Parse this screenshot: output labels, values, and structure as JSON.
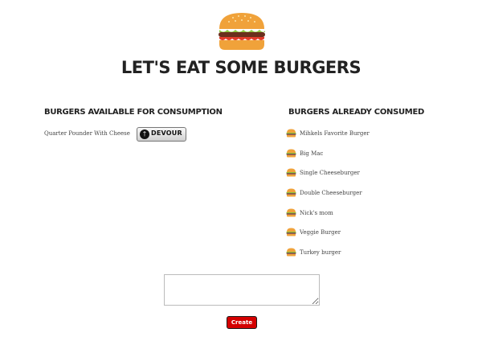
{
  "header": {
    "title": "LET'S EAT SOME BURGERS",
    "logo_icon": "burger-icon"
  },
  "available": {
    "heading": "BURGERS AVAILABLE FOR CONSUMPTION",
    "items": [
      {
        "name": "Quarter Pounder With Cheese",
        "button_label": "DEVOUR",
        "button_icon": "fork-knife-icon"
      }
    ]
  },
  "consumed": {
    "heading": "BURGERS ALREADY CONSUMED",
    "items": [
      "Mihkels Favorite Burger",
      "Big Mac",
      "Single Cheeseburger",
      "Double Cheeseburger",
      "Nick's mom",
      "Veggie Burger",
      "Turkey burger"
    ]
  },
  "form": {
    "textarea_value": "",
    "create_label": "Create"
  },
  "colors": {
    "bun": "#f0a23a",
    "patty": "#6b2f1d",
    "lettuce": "#8dc63f",
    "create_button": "#d40000"
  }
}
